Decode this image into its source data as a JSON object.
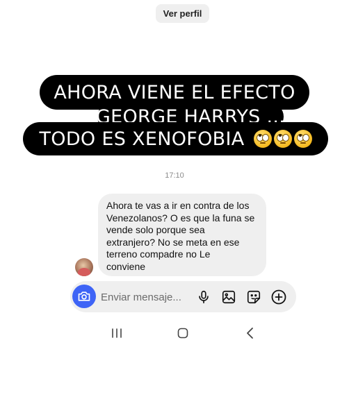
{
  "header": {
    "profile_button": "Ver perfil"
  },
  "story_caption": {
    "line1": "AHORA VIENE EL EFECTO",
    "line2": "GEORGE HARRYS ...",
    "line3": "TODO ES XENOFOBIA",
    "emoji": "face-with-rolling-eyes",
    "emoji_count": 3
  },
  "thread": {
    "timestamp": "17:10",
    "message_lines": [
      "Ahora te vas a ir en contra de los",
      "Venezolanos? O es que la funa se",
      "vende solo porque sea",
      "extranjero? No se meta en ese",
      "terreno compadre no Le",
      "conviene"
    ]
  },
  "composer": {
    "placeholder": "Enviar mensaje...",
    "value": "",
    "icons": [
      "camera-icon",
      "microphone-icon",
      "gallery-icon",
      "sticker-icon",
      "plus-icon"
    ],
    "accent_color": "#3e64f6"
  },
  "system_nav": {
    "buttons": [
      "recents",
      "home",
      "back"
    ]
  }
}
